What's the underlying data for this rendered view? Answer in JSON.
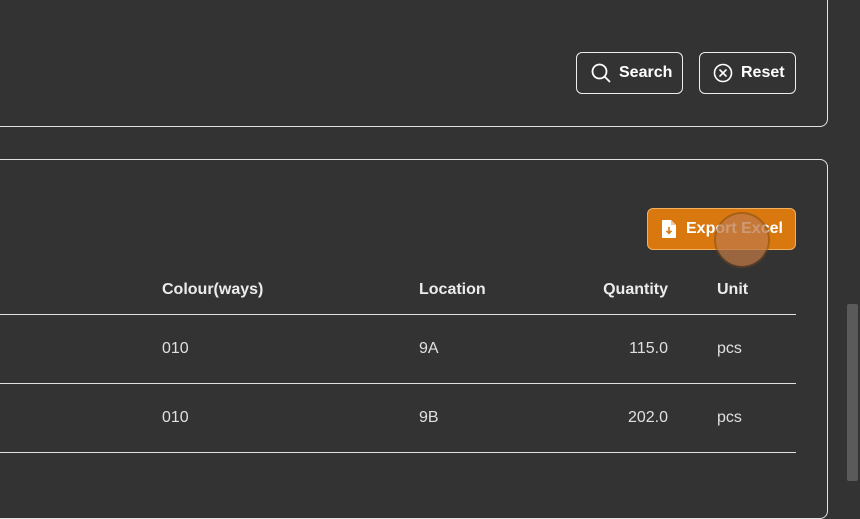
{
  "filters": {
    "search_label": "Search",
    "reset_label": "Reset"
  },
  "results": {
    "export_label": "Export Excel",
    "columns": {
      "colourways": "Colour(ways)",
      "location": "Location",
      "quantity": "Quantity",
      "unit": "Unit"
    },
    "rows": [
      {
        "colourways": "010",
        "location": "9A",
        "quantity": "115.0",
        "unit": "pcs"
      },
      {
        "colourways": "010",
        "location": "9B",
        "quantity": "202.0",
        "unit": "pcs"
      }
    ]
  },
  "colors": {
    "background": "#333333",
    "accent": "#d9780f",
    "border": "#e2e2e2"
  }
}
